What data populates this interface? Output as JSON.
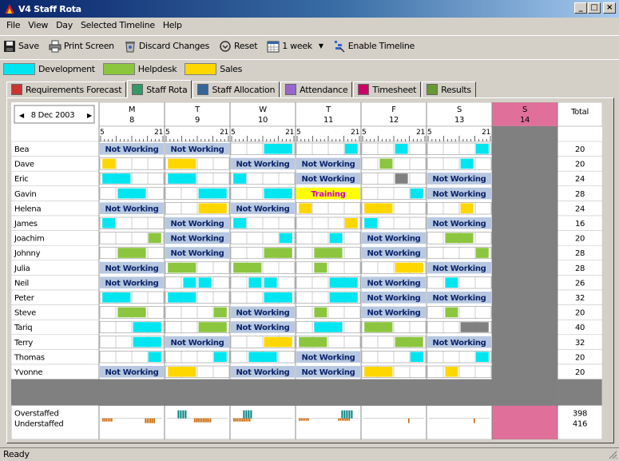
{
  "window": {
    "title": "V4 Staff Rota",
    "controls": [
      "_",
      "□",
      "×"
    ]
  },
  "menu": [
    "File",
    "View",
    "Day",
    "Selected Timeline",
    "Help"
  ],
  "toolbar": {
    "save": "Save",
    "print": "Print Screen",
    "discard": "Discard Changes",
    "reset": "Reset",
    "period": "1 week",
    "timeline": "Enable Timeline"
  },
  "legend": [
    {
      "label": "Development",
      "color": "#00e6f0"
    },
    {
      "label": "Helpdesk",
      "color": "#8cc63f"
    },
    {
      "label": "Sales",
      "color": "#ffd700"
    }
  ],
  "tabs": [
    {
      "label": "Requirements Forecast",
      "color": "#cc3333",
      "selected": false
    },
    {
      "label": "Staff Rota",
      "color": "#339966",
      "selected": true
    },
    {
      "label": "Staff Allocation",
      "color": "#336699",
      "selected": false
    },
    {
      "label": "Attendance",
      "color": "#9966cc",
      "selected": false
    },
    {
      "label": "Timesheet",
      "color": "#cc0066",
      "selected": false
    },
    {
      "label": "Results",
      "color": "#669933",
      "selected": false
    }
  ],
  "rota": {
    "date": "8 Dec 2003",
    "total_header": "Total",
    "hour_start": "5",
    "hour_end": "21",
    "not_working": "Not Working",
    "training": "Training",
    "days": [
      {
        "letter": "M",
        "num": "8",
        "closed": false
      },
      {
        "letter": "T",
        "num": "9",
        "closed": false
      },
      {
        "letter": "W",
        "num": "10",
        "closed": false
      },
      {
        "letter": "T",
        "num": "11",
        "closed": false
      },
      {
        "letter": "F",
        "num": "12",
        "closed": false
      },
      {
        "letter": "S",
        "num": "13",
        "closed": false
      },
      {
        "letter": "S",
        "num": "14",
        "closed": true
      }
    ],
    "staff": [
      {
        "name": "Bea",
        "total": "20",
        "cells": [
          "NW",
          "NW",
          [
            {
              "s": 0.52,
              "e": 0.96,
              "c": "D"
            }
          ],
          [
            {
              "s": 0.76,
              "e": 0.96,
              "c": "D"
            }
          ],
          [
            {
              "s": 0.52,
              "e": 0.72,
              "c": "D"
            }
          ],
          [
            {
              "s": 0.76,
              "e": 0.96,
              "c": "D"
            }
          ]
        ]
      },
      {
        "name": "Dave",
        "total": "20",
        "cells": [
          [
            {
              "s": 0.04,
              "e": 0.24,
              "c": "S"
            }
          ],
          [
            {
              "s": 0.04,
              "e": 0.48,
              "c": "S"
            }
          ],
          "NW",
          "NW",
          [
            {
              "s": 0.28,
              "e": 0.48,
              "c": "H"
            }
          ],
          [
            {
              "s": 0.52,
              "e": 0.72,
              "c": "D"
            }
          ]
        ]
      },
      {
        "name": "Eric",
        "total": "24",
        "cells": [
          [
            {
              "s": 0.04,
              "e": 0.48,
              "c": "D"
            }
          ],
          [
            {
              "s": 0.04,
              "e": 0.48,
              "c": "D"
            }
          ],
          [
            {
              "s": 0.04,
              "e": 0.24,
              "c": "D"
            }
          ],
          "NW",
          [
            {
              "s": 0.52,
              "e": 0.72,
              "c": "G"
            }
          ],
          "NW"
        ]
      },
      {
        "name": "Gavin",
        "total": "28",
        "cells": [
          [
            {
              "s": 0.28,
              "e": 0.72,
              "c": "D"
            }
          ],
          [
            {
              "s": 0.52,
              "e": 0.96,
              "c": "D"
            }
          ],
          [
            {
              "s": 0.52,
              "e": 0.96,
              "c": "D"
            }
          ],
          "TR",
          [
            {
              "s": 0.76,
              "e": 0.96,
              "c": "D"
            }
          ],
          "NW"
        ]
      },
      {
        "name": "Helena",
        "total": "24",
        "cells": [
          "NW",
          [
            {
              "s": 0.52,
              "e": 0.96,
              "c": "S"
            }
          ],
          "NW",
          [
            {
              "s": 0.04,
              "e": 0.24,
              "c": "S"
            }
          ],
          [
            {
              "s": 0.04,
              "e": 0.48,
              "c": "S"
            }
          ],
          [
            {
              "s": 0.52,
              "e": 0.72,
              "c": "S"
            }
          ]
        ]
      },
      {
        "name": "James",
        "total": "16",
        "cells": [
          [
            {
              "s": 0.04,
              "e": 0.24,
              "c": "D"
            }
          ],
          "NW",
          [
            {
              "s": 0.04,
              "e": 0.24,
              "c": "D"
            }
          ],
          [
            {
              "s": 0.76,
              "e": 0.96,
              "c": "S"
            }
          ],
          [
            {
              "s": 0.04,
              "e": 0.24,
              "c": "D"
            }
          ],
          "NW"
        ]
      },
      {
        "name": "Joachim",
        "total": "20",
        "cells": [
          [
            {
              "s": 0.76,
              "e": 0.96,
              "c": "H"
            }
          ],
          "NW",
          [
            {
              "s": 0.76,
              "e": 0.96,
              "c": "D"
            }
          ],
          [
            {
              "s": 0.52,
              "e": 0.72,
              "c": "D"
            }
          ],
          "NW",
          [
            {
              "s": 0.28,
              "e": 0.72,
              "c": "H"
            }
          ]
        ]
      },
      {
        "name": "Johnny",
        "total": "28",
        "cells": [
          [
            {
              "s": 0.28,
              "e": 0.72,
              "c": "H"
            }
          ],
          "NW",
          [
            {
              "s": 0.52,
              "e": 0.96,
              "c": "H"
            }
          ],
          [
            {
              "s": 0.28,
              "e": 0.72,
              "c": "H"
            }
          ],
          "NW",
          [
            {
              "s": 0.76,
              "e": 0.96,
              "c": "H"
            }
          ]
        ]
      },
      {
        "name": "Julia",
        "total": "28",
        "cells": [
          "NW",
          [
            {
              "s": 0.04,
              "e": 0.48,
              "c": "H"
            }
          ],
          [
            {
              "s": 0.04,
              "e": 0.48,
              "c": "H"
            }
          ],
          [
            {
              "s": 0.28,
              "e": 0.48,
              "c": "H"
            }
          ],
          [
            {
              "s": 0.52,
              "e": 0.96,
              "c": "S"
            }
          ],
          "NW"
        ]
      },
      {
        "name": "Neil",
        "total": "26",
        "cells": [
          "NW",
          [
            {
              "s": 0.28,
              "e": 0.48,
              "c": "D"
            },
            {
              "s": 0.52,
              "e": 0.72,
              "c": "D"
            }
          ],
          [
            {
              "s": 0.28,
              "e": 0.48,
              "c": "D"
            },
            {
              "s": 0.52,
              "e": 0.72,
              "c": "D"
            }
          ],
          [
            {
              "s": 0.52,
              "e": 0.96,
              "c": "D"
            }
          ],
          "NW",
          [
            {
              "s": 0.28,
              "e": 0.48,
              "c": "D"
            }
          ]
        ]
      },
      {
        "name": "Peter",
        "total": "32",
        "cells": [
          [
            {
              "s": 0.04,
              "e": 0.48,
              "c": "D"
            }
          ],
          [
            {
              "s": 0.04,
              "e": 0.48,
              "c": "D"
            }
          ],
          [
            {
              "s": 0.52,
              "e": 0.96,
              "c": "D"
            }
          ],
          [
            {
              "s": 0.52,
              "e": 0.96,
              "c": "D"
            }
          ],
          "NW",
          "NW"
        ]
      },
      {
        "name": "Steve",
        "total": "20",
        "cells": [
          [
            {
              "s": 0.28,
              "e": 0.72,
              "c": "H"
            }
          ],
          [
            {
              "s": 0.76,
              "e": 0.96,
              "c": "H"
            }
          ],
          "NW",
          [
            {
              "s": 0.28,
              "e": 0.48,
              "c": "H"
            }
          ],
          "NW",
          [
            {
              "s": 0.28,
              "e": 0.48,
              "c": "H"
            }
          ]
        ]
      },
      {
        "name": "Tariq",
        "total": "40",
        "cells": [
          [
            {
              "s": 0.52,
              "e": 0.96,
              "c": "D"
            }
          ],
          [
            {
              "s": 0.52,
              "e": 0.96,
              "c": "H"
            }
          ],
          "NW",
          [
            {
              "s": 0.28,
              "e": 0.72,
              "c": "D"
            }
          ],
          [
            {
              "s": 0.04,
              "e": 0.48,
              "c": "H"
            }
          ],
          [
            {
              "s": 0.52,
              "e": 0.96,
              "c": "G"
            }
          ]
        ]
      },
      {
        "name": "Terry",
        "total": "32",
        "cells": [
          [
            {
              "s": 0.52,
              "e": 0.96,
              "c": "D"
            }
          ],
          "NW",
          [
            {
              "s": 0.52,
              "e": 0.96,
              "c": "S"
            }
          ],
          [
            {
              "s": 0.04,
              "e": 0.48,
              "c": "H"
            }
          ],
          [
            {
              "s": 0.52,
              "e": 0.96,
              "c": "H"
            }
          ],
          "NW"
        ]
      },
      {
        "name": "Thomas",
        "total": "20",
        "cells": [
          [
            {
              "s": 0.76,
              "e": 0.96,
              "c": "D"
            }
          ],
          [
            {
              "s": 0.76,
              "e": 0.96,
              "c": "D"
            }
          ],
          [
            {
              "s": 0.28,
              "e": 0.72,
              "c": "D"
            }
          ],
          "NW",
          [
            {
              "s": 0.76,
              "e": 0.96,
              "c": "D"
            }
          ],
          [
            {
              "s": 0.76,
              "e": 0.96,
              "c": "D"
            }
          ]
        ]
      },
      {
        "name": "Yvonne",
        "total": "20",
        "cells": [
          "NW",
          [
            {
              "s": 0.04,
              "e": 0.48,
              "c": "S"
            }
          ],
          "NW",
          "NW",
          [
            {
              "s": 0.04,
              "e": 0.48,
              "c": "S"
            }
          ],
          [
            {
              "s": 0.28,
              "e": 0.48,
              "c": "S"
            }
          ]
        ]
      }
    ],
    "overstaffed_label": "Overstaffed",
    "understaffed_label": "Understaffed",
    "overstaffed_total": "398",
    "understaffed_total": "416"
  },
  "colors": {
    "D": "#00e6f0",
    "H": "#8cc63f",
    "S": "#ffd700",
    "G": "#808080",
    "nw_bg": "#b8c8e0",
    "nw_text": "#0a246a",
    "training_bg": "#ffff00",
    "training_text": "#cc00cc",
    "closed": "#808080",
    "closed_header": "#e0709a",
    "over": "#008080",
    "under": "#cc6600"
  },
  "status": "Ready"
}
